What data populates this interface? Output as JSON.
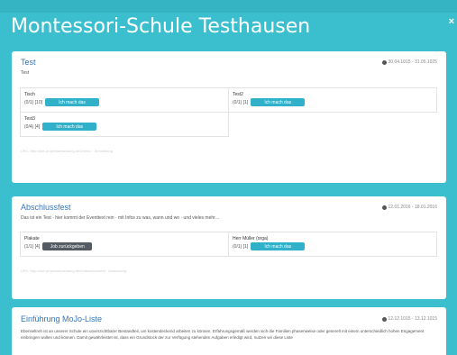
{
  "header": {
    "title": "Montessori-Schule Testhausen",
    "close_label": "×"
  },
  "cards": [
    {
      "title": "Test",
      "date": "30.04.1015 - 31.05.1025",
      "desc": "Test",
      "slots": [
        {
          "name": "Tisch",
          "count": "(0/1) [10]",
          "button": "Ich mach das"
        },
        {
          "name": "Test2",
          "count": "(0/1) [1]",
          "button": "Ich mach das"
        },
        {
          "name": "Test3",
          "count": "(0/4) [4]",
          "button": "Ich mach das"
        }
      ],
      "footer": "URL: http://site-projektanmeldung.de/#/test1 · Anmeldung"
    },
    {
      "title": "Abschlussfest",
      "date": "12.01.2016 - 18.01.2016",
      "desc": "Das ist ein Test · hier kommt der Eventtext rein · mit Infos zu was, wann und wo · und vieles mehr…",
      "slots": [
        {
          "name": "Plakate",
          "count": "(1/1) [4]",
          "button": "Job zurückgeben"
        },
        {
          "name": "Herr Müller (orga)",
          "count": "(0/1) [1]",
          "button": "Ich mach das"
        }
      ],
      "footer": "URL: http://site-projektanmeldung.de/#/abschlussfest · Anmeldung"
    },
    {
      "title": "Einführung MoJo-Liste",
      "date": "12.12.1015 - 13.12.1015",
      "text": "Ebenseltreh ist an unserer Schule ein unverzichtbarer Bestandteil, um kostendeckend arbeiten zu können. Erfahrungsgemäß werden sich die Familien phasenweise oder generell mit einem unterschiedlich hohen Engagement einbringen wollen und können. Damit gewährleistet ist, dass ein Grundstock der zur Verfügung stehenden Aufgaben erledigt wird, nutzen wir diese Liste"
    }
  ],
  "colors": {
    "background": "#3bbfce",
    "title_link": "#3576b8",
    "button": "#31b0c9",
    "button_undo": "#555b63"
  },
  "icons": {
    "date": "clock-icon",
    "close": "close-icon"
  }
}
